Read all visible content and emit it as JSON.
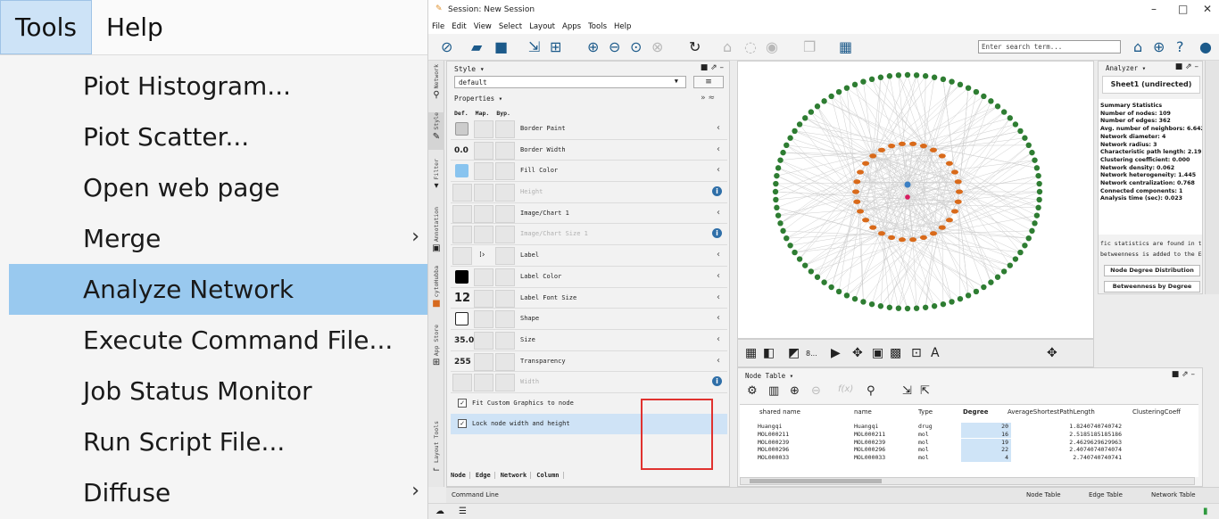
{
  "zoom_menu": {
    "menubar": [
      "Tools",
      "Help"
    ],
    "items": [
      {
        "label": "Piot Histogram...",
        "submenu": false,
        "highlight": false
      },
      {
        "label": "Piot Scatter...",
        "submenu": false,
        "highlight": false
      },
      {
        "label": "Open web page",
        "submenu": false,
        "highlight": false
      },
      {
        "label": "Merge",
        "submenu": true,
        "highlight": false
      },
      {
        "label": "Analyze Network",
        "submenu": false,
        "highlight": true
      },
      {
        "label": "Execute Command File...",
        "submenu": false,
        "highlight": false
      },
      {
        "label": "Job Status Monitor",
        "submenu": false,
        "highlight": false
      },
      {
        "label": "Run Script File...",
        "submenu": false,
        "highlight": false
      },
      {
        "label": "Diffuse",
        "submenu": true,
        "highlight": false
      }
    ]
  },
  "window": {
    "title": "Session: New Session",
    "menubar": [
      "File",
      "Edit",
      "View",
      "Select",
      "Layout",
      "Apps",
      "Tools",
      "Help"
    ],
    "search_placeholder": "Enter search term...",
    "vertical_tabs": [
      "Network",
      "Style",
      "Filter",
      "Annotation",
      "cytoHubba",
      "App Store",
      "Layout Tools"
    ]
  },
  "style_panel": {
    "header": "Style ▾",
    "style_name": "default",
    "properties_label": "Properties ▾",
    "columns": [
      "Def.",
      "Map.",
      "Byp."
    ],
    "properties": [
      {
        "name": "Border Paint",
        "def": "",
        "swatch": "#cccccc",
        "dim": false,
        "info": false
      },
      {
        "name": "Border Width",
        "def": "0.0",
        "swatch": "",
        "dim": false,
        "info": false
      },
      {
        "name": "Fill Color",
        "def": "",
        "swatch": "#89c4ef",
        "dim": false,
        "info": false
      },
      {
        "name": "Height",
        "def": "",
        "swatch": "",
        "dim": true,
        "info": true
      },
      {
        "name": "Image/Chart 1",
        "def": "",
        "swatch": "",
        "dim": false,
        "info": false
      },
      {
        "name": "Image/Chart Size 1",
        "def": "",
        "swatch": "",
        "dim": true,
        "info": true
      },
      {
        "name": "Label",
        "def": "",
        "swatch": "",
        "dim": false,
        "info": false
      },
      {
        "name": "Label Color",
        "def": "",
        "swatch": "#000000",
        "dim": false,
        "info": false
      },
      {
        "name": "Label Font Size",
        "def": "12",
        "swatch": "",
        "dim": false,
        "info": false
      },
      {
        "name": "Shape",
        "def": "",
        "swatch": "shape",
        "dim": false,
        "info": false
      },
      {
        "name": "Size",
        "def": "35.0",
        "swatch": "",
        "dim": false,
        "info": false
      },
      {
        "name": "Transparency",
        "def": "255",
        "swatch": "",
        "dim": false,
        "info": false
      },
      {
        "name": "Width",
        "def": "",
        "swatch": "",
        "dim": true,
        "info": true
      }
    ],
    "checkboxes": [
      "Fit Custom Graphics to node",
      "Lock node width and height"
    ],
    "bottom_tabs": [
      "Node",
      "Edge",
      "Network",
      "Column"
    ]
  },
  "canvas_tools": {
    "label_glyph": "8..."
  },
  "analyzer": {
    "header": "Analyzer ▾",
    "title": "Sheet1 (undirected)",
    "stats": [
      "Summary Statistics",
      "Number of nodes: 109",
      "Number of edges: 362",
      "Avg. number of neighbors:  6.642",
      "Network diameter:  4",
      "Network radius:  3",
      "Characteristic path length:  2.191",
      "Clustering coefficient:  0.000",
      "Network density:  0.062",
      "Network heterogeneity:  1.445",
      "Network centralization:  0.768",
      "Connected components:  1",
      "Analysis time (sec):  0.023"
    ],
    "messages": [
      "fic statistics are found in th",
      "betweenness is added to the Ed"
    ],
    "buttons": [
      "Node Degree Distribution",
      "Betweenness by Degree"
    ]
  },
  "node_table": {
    "header": "Node Table ▾",
    "columns": [
      "shared name",
      "name",
      "Type",
      "Degree",
      "AverageShortestPathLength",
      "ClusteringCoeff"
    ],
    "rows": [
      [
        "Huangqi",
        "Huangqi",
        "drug",
        "20",
        "1.8240740740742"
      ],
      [
        "MOL000211",
        "MOL000211",
        "mol",
        "16",
        "2.5185185185186"
      ],
      [
        "MOL000239",
        "MOL000239",
        "mol",
        "19",
        "2.4629629629963"
      ],
      [
        "MOL000296",
        "MOL000296",
        "mol",
        "22",
        "2.4074074074074"
      ],
      [
        "MOL000033",
        "MOL000033",
        "mol",
        "4",
        "2.740740740741"
      ]
    ]
  },
  "bottom": {
    "command_line": "Command Line",
    "tabs": [
      "Node Table",
      "Edge Table",
      "Network Table"
    ]
  },
  "colors": {
    "menu_highlight": "#99c9ef",
    "outer_node": "#2e7d32",
    "inner_node": "#d96a1a",
    "center_node_1": "#3b7fc4",
    "center_node_2": "#d81b60",
    "degree_highlight_border": "#e0322f"
  }
}
